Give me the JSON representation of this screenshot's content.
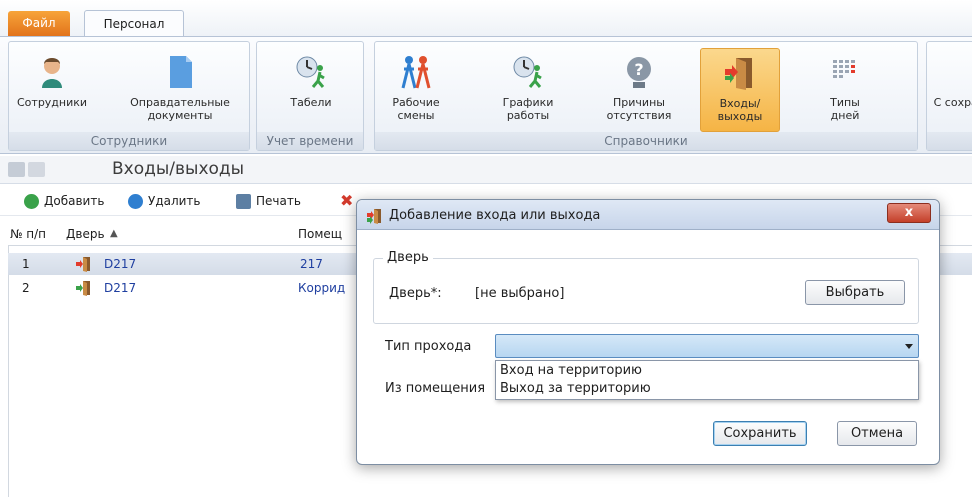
{
  "ribbon_tabs": {
    "file": "Файл",
    "personal": "Персонал"
  },
  "ribbon": {
    "groups": [
      {
        "label": "Сотрудники",
        "buttons": [
          {
            "label": "Сотрудники"
          },
          {
            "label": "Оправдательные документы"
          }
        ]
      },
      {
        "label": "Учет времени",
        "buttons": [
          {
            "label": "Табели"
          }
        ]
      },
      {
        "label": "Справочники",
        "buttons": [
          {
            "label": "Рабочие смены"
          },
          {
            "label": "Графики работы"
          },
          {
            "label": "Причины отсутствия"
          },
          {
            "label": "Входы/выходы",
            "active": true
          },
          {
            "label": "Типы дней"
          }
        ]
      },
      {
        "label": "",
        "buttons": [
          {
            "label": "С сохран"
          }
        ]
      }
    ]
  },
  "page_title": "Входы/выходы",
  "toolbar": {
    "add": "Добавить",
    "delete": "Удалить",
    "print": "Печать"
  },
  "grid": {
    "columns": [
      "№ п/п",
      "Дверь",
      "Помещ"
    ],
    "rows": [
      {
        "num": "1",
        "door": "D217",
        "room": "217",
        "selected": true
      },
      {
        "num": "2",
        "door": "D217",
        "room": "Коррид",
        "selected": false
      }
    ]
  },
  "dialog": {
    "title": "Добавление входа или выхода",
    "close": "x",
    "door_section": "Дверь",
    "door_label": "Дверь*:",
    "door_value": "[не выбрано]",
    "choose_button": "Выбрать",
    "pass_type_label": "Тип прохода",
    "pass_type_options": [
      "Вход на территорию",
      "Выход за территорию"
    ],
    "from_room_label": "Из помещения",
    "save_button": "Сохранить",
    "cancel_button": "Отмена"
  },
  "colors": {
    "accent_orange": "#f5b445",
    "link_blue": "#1f3fa0",
    "combo_blue": "#b7d6f1"
  }
}
